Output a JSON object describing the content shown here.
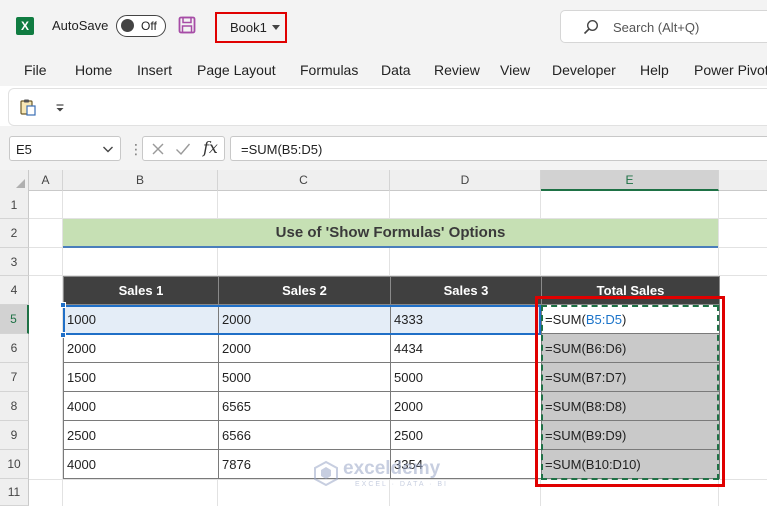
{
  "titlebar": {
    "app_icon": "excel-logo",
    "app_letter": "X",
    "autosave_label": "AutoSave",
    "autosave_state": "Off",
    "save_icon": "save-icon",
    "book_name": "Book1",
    "search_placeholder": "Search (Alt+Q)"
  },
  "menu": [
    "File",
    "Home",
    "Insert",
    "Page Layout",
    "Formulas",
    "Data",
    "Review",
    "View",
    "Developer",
    "Help",
    "Power Pivot"
  ],
  "quickbar": {
    "paste_icon": "paste-icon",
    "customize_icon": "qa-caret-icon"
  },
  "formula_bar": {
    "name_box": "E5",
    "separator": "⋮",
    "fx_label": "fx",
    "formula": "=SUM(B5:D5)"
  },
  "grid": {
    "columns": [
      "A",
      "B",
      "C",
      "D",
      "E"
    ],
    "selected_column": "E",
    "rows": [
      "1",
      "2",
      "3",
      "4",
      "5",
      "6",
      "7",
      "8",
      "9",
      "10",
      "11"
    ],
    "selected_row": "5"
  },
  "sheet": {
    "title": "Use of 'Show Formulas' Options",
    "headers": [
      "Sales 1",
      "Sales 2",
      "Sales 3",
      "Total Sales"
    ],
    "rows": [
      {
        "b": "1000",
        "c": "2000",
        "d": "4333",
        "e_fn": "=SUM(",
        "e_ref": "B5:D5",
        "e_close": ")"
      },
      {
        "b": "2000",
        "c": "2000",
        "d": "4434",
        "e_fn": "=SUM(B6:D6)",
        "e_ref": "",
        "e_close": ""
      },
      {
        "b": "1500",
        "c": "5000",
        "d": "5000",
        "e_fn": "=SUM(B7:D7)",
        "e_ref": "",
        "e_close": ""
      },
      {
        "b": "4000",
        "c": "6565",
        "d": "2000",
        "e_fn": "=SUM(B8:D8)",
        "e_ref": "",
        "e_close": ""
      },
      {
        "b": "2500",
        "c": "6566",
        "d": "2500",
        "e_fn": "=SUM(B9:D9)",
        "e_ref": "",
        "e_close": ""
      },
      {
        "b": "4000",
        "c": "7876",
        "d": "3354",
        "e_fn": "=SUM(B10:D10)",
        "e_ref": "",
        "e_close": ""
      }
    ]
  },
  "watermark": {
    "name": "exceldemy",
    "tagline": "EXCEL · DATA · BI"
  },
  "colors": {
    "excel_green": "#107c41",
    "highlight_red": "#e00000",
    "title_fill": "#c6e0b4",
    "header_fill": "#404040",
    "formula_fill": "#c9c9c9",
    "reference_blue": "#1a73c9"
  }
}
